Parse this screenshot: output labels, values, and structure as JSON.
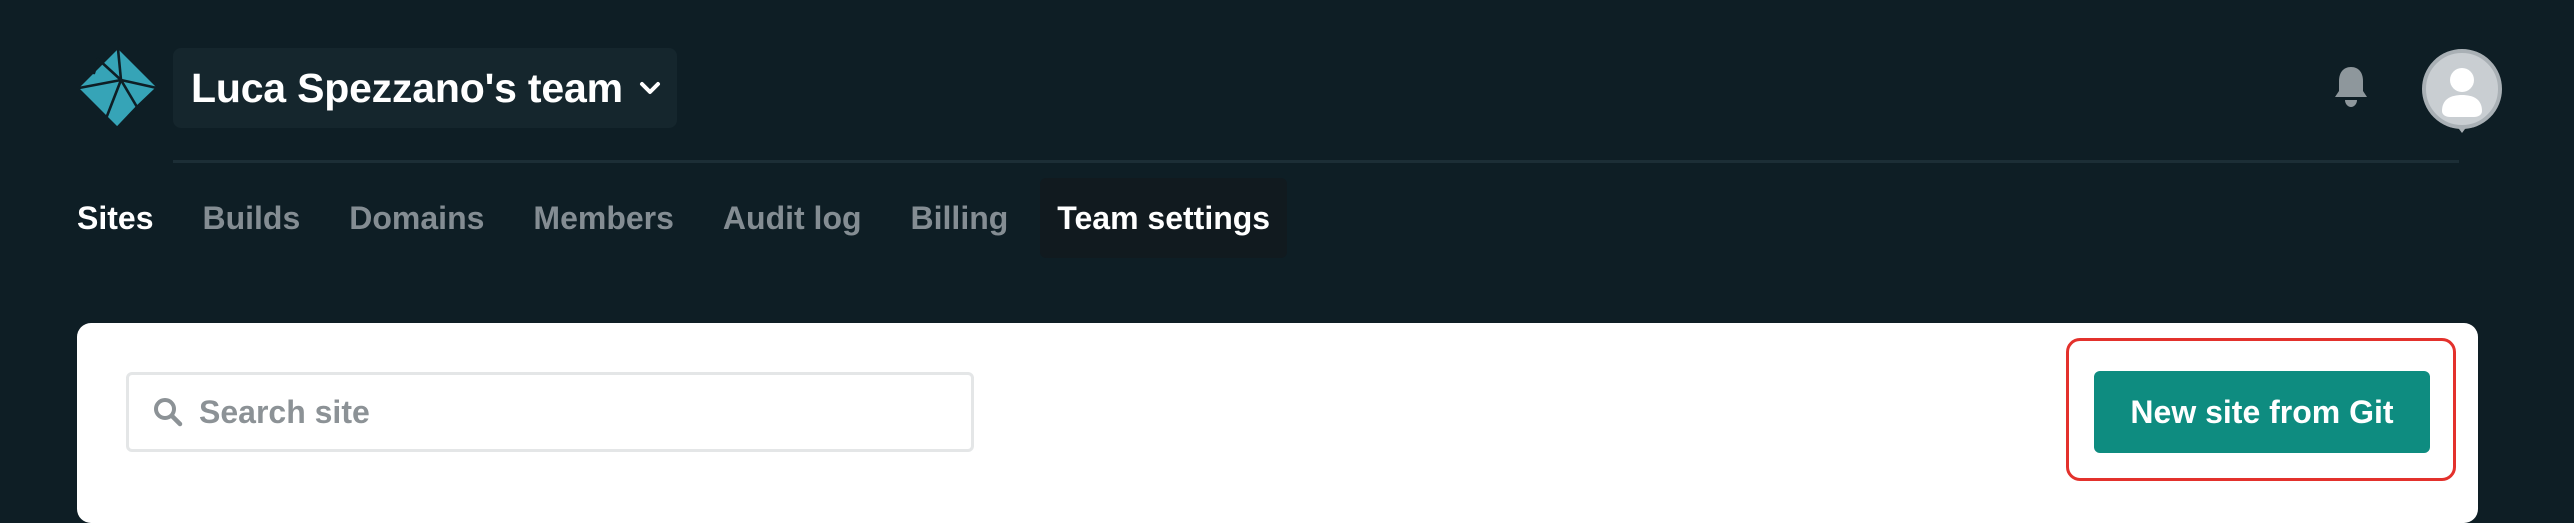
{
  "header": {
    "logo_icon": "netlify-logo-icon",
    "team_name": "Luca Spezzano's team",
    "team_dropdown_icon": "chevron-down-icon",
    "notifications_icon": "bell-icon",
    "avatar_icon": "user-avatar-icon"
  },
  "nav": {
    "tabs": [
      {
        "label": "Sites",
        "state": "active"
      },
      {
        "label": "Builds"
      },
      {
        "label": "Domains"
      },
      {
        "label": "Members"
      },
      {
        "label": "Audit log"
      },
      {
        "label": "Billing"
      },
      {
        "label": "Team settings",
        "state": "hovered"
      }
    ]
  },
  "main": {
    "search": {
      "icon": "search-icon",
      "placeholder": "Search site",
      "value": ""
    },
    "new_site_button_label": "New site from Git"
  },
  "colors": {
    "background": "#0e1e25",
    "panel": "#ffffff",
    "primary_button": "#0e8c80",
    "highlight_outline": "#e3312c",
    "inactive_tab": "#848d93",
    "active_tab": "#ffffff"
  }
}
